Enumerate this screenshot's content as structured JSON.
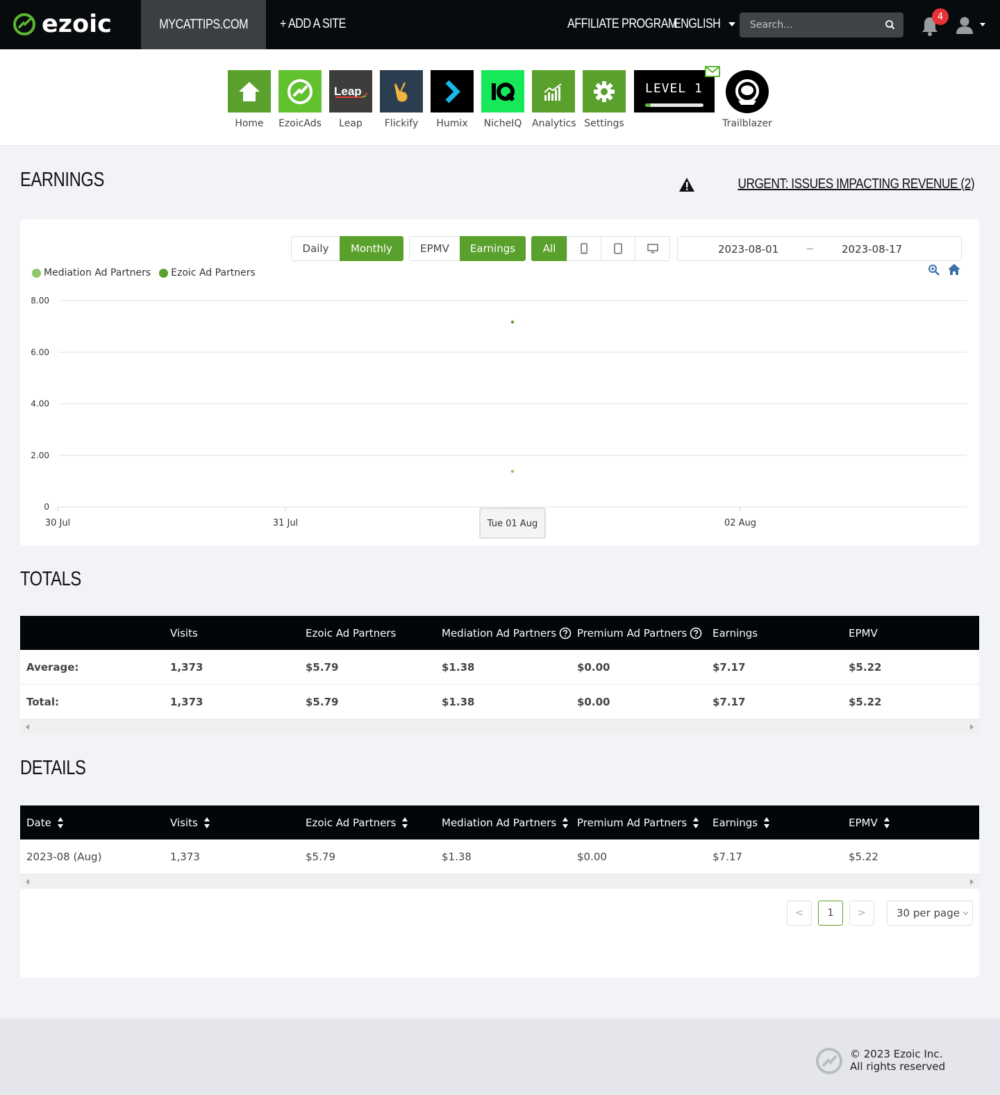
{
  "topbar": {
    "logo_text": "ezoic",
    "site_tab": "MYCATTIPS.COM",
    "add_site": "+ ADD A SITE",
    "affiliate": "AFFILIATE PROGRAM",
    "language": "ENGLISH",
    "search_placeholder": "Search...",
    "notification_count": "4"
  },
  "apps": [
    {
      "label": "Home",
      "icon": "home-icon",
      "color": "#5aa02c"
    },
    {
      "label": "EzoicAds",
      "icon": "ezoic-ads-icon",
      "color": "#62c12f"
    },
    {
      "label": "Leap",
      "icon": "leap-icon",
      "color": "#3d3d3d"
    },
    {
      "label": "Flickify",
      "icon": "flickify-icon",
      "color": "#2b3e4f"
    },
    {
      "label": "Humix",
      "icon": "humix-icon",
      "color": "#000000"
    },
    {
      "label": "NicheIQ",
      "icon": "nicheiq-icon",
      "color": "#17e85a"
    },
    {
      "label": "Analytics",
      "icon": "analytics-icon",
      "color": "#5aa02c"
    },
    {
      "label": "Settings",
      "icon": "settings-icon",
      "color": "#5aa02c"
    }
  ],
  "level": {
    "text": "LEVEL 1",
    "progress": 0.1
  },
  "trailblazer": {
    "label": "Trailblazer"
  },
  "earnings": {
    "heading": "EARNINGS",
    "urgent": "URGENT: ISSUES IMPACTING REVENUE (2)"
  },
  "controls": {
    "period": [
      "Daily",
      "Monthly"
    ],
    "period_active": "Monthly",
    "metric": [
      "EPMV",
      "Earnings"
    ],
    "metric_active": "Earnings",
    "device_all": "All",
    "date_start": "2023-08-01",
    "date_sep": "~",
    "date_end": "2023-08-17"
  },
  "colors": {
    "accent": "#5aa02c",
    "mediation": "#8cc76a",
    "ezoic": "#5aa02c"
  },
  "chart_data": {
    "type": "scatter",
    "x_ticks": [
      "30 Jul",
      "31 Jul",
      "02 Aug"
    ],
    "tooltip_label": "Tue 01 Aug",
    "y_ticks": [
      "8.00",
      "6.00",
      "4.00",
      "2.00",
      "0"
    ],
    "ylim": [
      0,
      8
    ],
    "legend": [
      "Mediation Ad Partners",
      "Ezoic Ad Partners"
    ],
    "series": [
      {
        "name": "Mediation Ad Partners",
        "x": "2023-08-01",
        "y": 1.38
      },
      {
        "name": "Ezoic Ad Partners",
        "x": "2023-08-01",
        "y": 7.17
      }
    ]
  },
  "totals": {
    "heading": "TOTALS",
    "columns": [
      "",
      "Visits",
      "Ezoic Ad Partners",
      "Mediation Ad Partners",
      "Premium Ad Partners",
      "Earnings",
      "EPMV"
    ],
    "rows": [
      [
        "Average:",
        "1,373",
        "$5.79",
        "$1.38",
        "$0.00",
        "$7.17",
        "$5.22"
      ],
      [
        "Total:",
        "1,373",
        "$5.79",
        "$1.38",
        "$0.00",
        "$7.17",
        "$5.22"
      ]
    ]
  },
  "details": {
    "heading": "DETAILS",
    "columns": [
      "Date",
      "Visits",
      "Ezoic Ad Partners",
      "Mediation Ad Partners",
      "Premium Ad Partners",
      "Earnings",
      "EPMV"
    ],
    "rows": [
      [
        "2023-08 (Aug)",
        "1,373",
        "$5.79",
        "$1.38",
        "$0.00",
        "$7.17",
        "$5.22"
      ]
    ],
    "pager_prev": "<",
    "pager_current": "1",
    "pager_next": ">",
    "per_page": "30 per page"
  },
  "footer": {
    "copyright": "© 2023 Ezoic Inc.",
    "rights": "All rights reserved"
  }
}
